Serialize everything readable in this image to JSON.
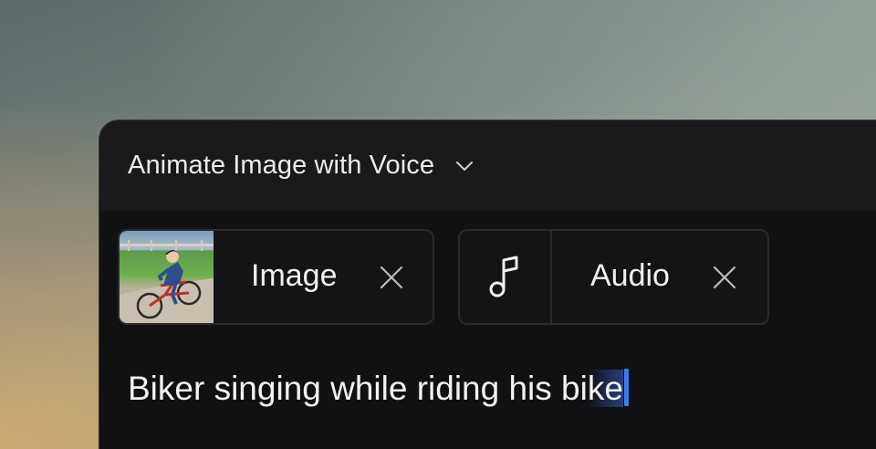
{
  "header": {
    "mode_label": "Animate Image with Voice",
    "dropdown_icon": "chevron-down-icon"
  },
  "inputs": [
    {
      "kind": "image",
      "label": "Image",
      "icon": "image-thumbnail",
      "remove_icon": "close-icon"
    },
    {
      "kind": "audio",
      "label": "Audio",
      "icon": "music-note-icon",
      "remove_icon": "close-icon"
    }
  ],
  "prompt": {
    "text_main": "Biker singing while riding his bi",
    "text_selected": "ke"
  },
  "colors": {
    "panel_bg": "#111113",
    "header_bg": "#1a1a1c",
    "caret": "#3b7bf0",
    "text": "#f0f0f0"
  }
}
